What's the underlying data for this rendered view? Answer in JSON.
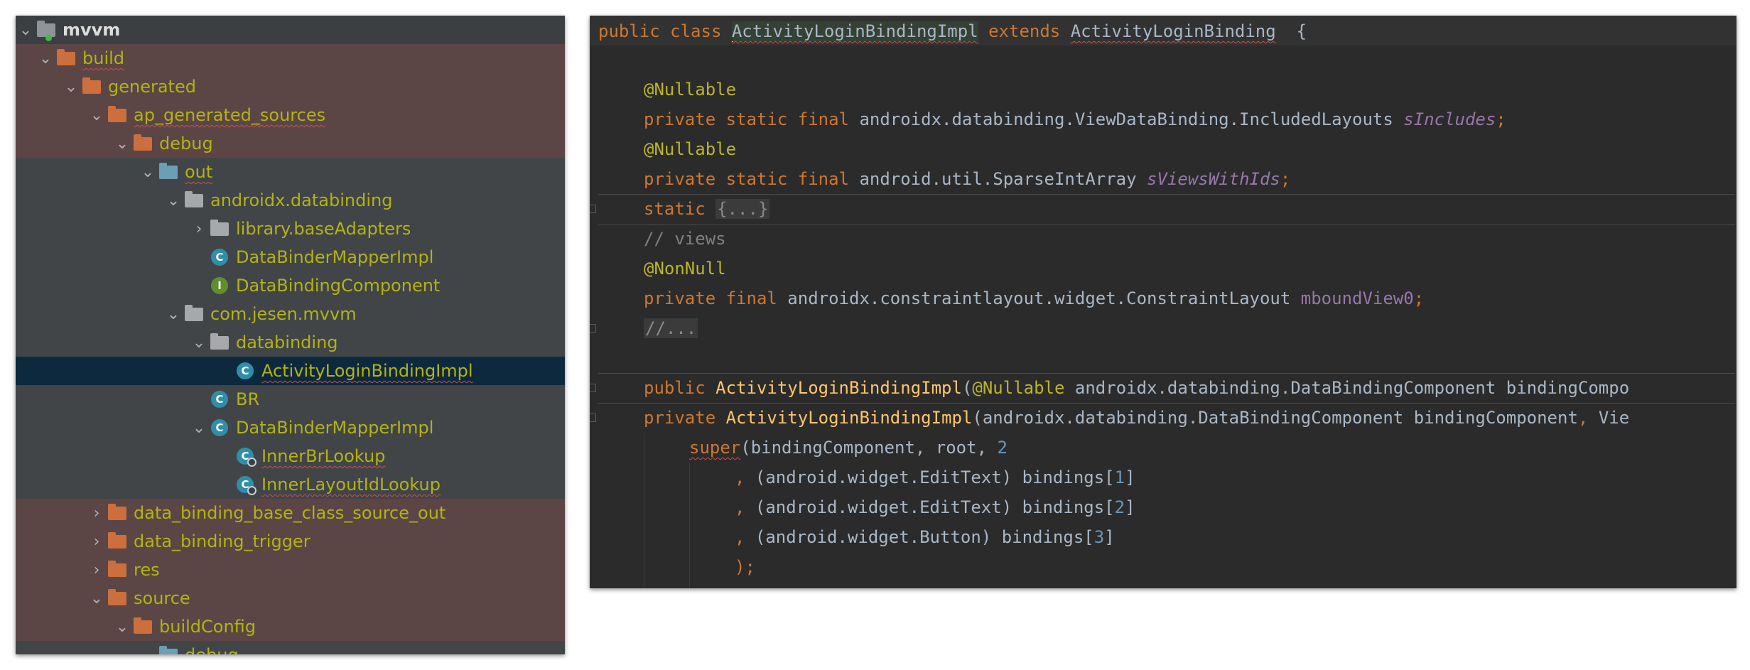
{
  "tree": {
    "items": [
      {
        "label": "mvvm"
      },
      {
        "label": "build"
      },
      {
        "label": "generated"
      },
      {
        "label": "ap_generated_sources"
      },
      {
        "label": "debug"
      },
      {
        "label": "out"
      },
      {
        "label": "androidx.databinding"
      },
      {
        "label": "library.baseAdapters"
      },
      {
        "label": "DataBinderMapperImpl"
      },
      {
        "label": "DataBindingComponent"
      },
      {
        "label": "com.jesen.mvvm"
      },
      {
        "label": "databinding"
      },
      {
        "label": "ActivityLoginBindingImpl"
      },
      {
        "label": "BR"
      },
      {
        "label": "DataBinderMapperImpl"
      },
      {
        "label": "InnerBrLookup"
      },
      {
        "label": "InnerLayoutIdLookup"
      },
      {
        "label": "data_binding_base_class_source_out"
      },
      {
        "label": "data_binding_trigger"
      },
      {
        "label": "res"
      },
      {
        "label": "source"
      },
      {
        "label": "buildConfig"
      },
      {
        "label": "debug"
      }
    ],
    "icon_letters": {
      "class": "C",
      "interface": "I"
    },
    "colors": {
      "excluded_row": "#5b4645",
      "selected_row": "#0d293e",
      "label": "#b4b214",
      "folder": "#cc6f3c"
    }
  },
  "code": {
    "line1": {
      "kw1": "public",
      "kw2": "class",
      "name": "ActivityLoginBindingImpl",
      "kw3": "extends",
      "base": "ActivityLoginBinding",
      "brace": "{"
    },
    "line2": {
      "ann": "@Nullable"
    },
    "line3": {
      "mods": "private static final",
      "type": "androidx.databinding.ViewDataBinding.IncludedLayouts",
      "field": "sIncludes",
      "semi": ";"
    },
    "line4": {
      "ann": "@Nullable"
    },
    "line5": {
      "mods": "private static final",
      "type": "android.util.SparseIntArray",
      "field": "sViewsWithIds",
      "semi": ";"
    },
    "line6": {
      "kw": "static",
      "fold": "{...}"
    },
    "line7": {
      "comment": "// views"
    },
    "line8": {
      "ann": "@NonNull"
    },
    "line9": {
      "mods": "private final",
      "type": "androidx.constraintlayout.widget.ConstraintLayout",
      "field": "mboundView0",
      "semi": ";"
    },
    "line10": {
      "fold": "//..."
    },
    "line11": {
      "kw": "public",
      "name": "ActivityLoginBindingImpl",
      "paren": "(",
      "ann": "@Nullable",
      "rest": "androidx.databinding.DataBindingComponent bindingCompo"
    },
    "line12": {
      "kw": "private",
      "name": "ActivityLoginBindingImpl",
      "rest": "(androidx.databinding.DataBindingComponent bindingComponent",
      "comma": ",",
      "tail": "Vie"
    },
    "line13": {
      "call": "super",
      "rest": "(bindingComponent, root, ",
      "num": "2"
    },
    "line14": {
      "comma": ",",
      "rest": "(android.widget.EditText) bindings[",
      "num": "1",
      "end": "]"
    },
    "line15": {
      "comma": ",",
      "rest": "(android.widget.EditText) bindings[",
      "num": "2",
      "end": "]"
    },
    "line16": {
      "comma": ",",
      "rest": "(android.widget.Button) bindings[",
      "num": "3",
      "end": "]"
    },
    "line17": {
      "text": ");"
    }
  }
}
